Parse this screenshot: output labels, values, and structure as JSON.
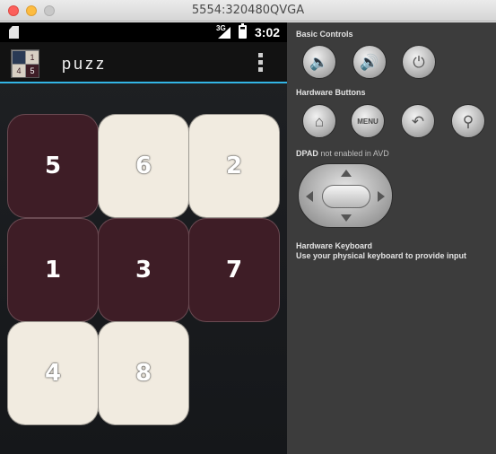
{
  "window": {
    "title": "5554:320480QVGA"
  },
  "statusbar": {
    "network": "3G",
    "time": "3:02"
  },
  "app": {
    "title": "puzz",
    "icon_digits": [
      "",
      "1",
      "4",
      "5"
    ]
  },
  "board": {
    "tiles": [
      {
        "label": "5",
        "style": "dark"
      },
      {
        "label": "6",
        "style": "light"
      },
      {
        "label": "2",
        "style": "light"
      },
      {
        "label": "1",
        "style": "dark"
      },
      {
        "label": "3",
        "style": "dark"
      },
      {
        "label": "7",
        "style": "dark"
      },
      {
        "label": "4",
        "style": "light"
      },
      {
        "label": "8",
        "style": "light"
      }
    ]
  },
  "panel": {
    "basic_controls": {
      "label": "Basic Controls",
      "buttons": [
        "volume-down-icon",
        "volume-up-icon",
        "power-icon"
      ]
    },
    "hardware_buttons": {
      "label": "Hardware Buttons",
      "menu_label": "MENU",
      "buttons": [
        "home-icon",
        "menu",
        "back-icon",
        "search-icon"
      ]
    },
    "dpad": {
      "label": "DPAD",
      "note": "not enabled in AVD"
    },
    "keyboard": {
      "label": "Hardware Keyboard",
      "note": "Use your physical keyboard to provide input"
    }
  },
  "colors": {
    "tile_dark": "#3e1d26",
    "tile_light": "#f1ebe0",
    "accent": "#33b5e5",
    "panel_bg": "#3c3c3c"
  }
}
